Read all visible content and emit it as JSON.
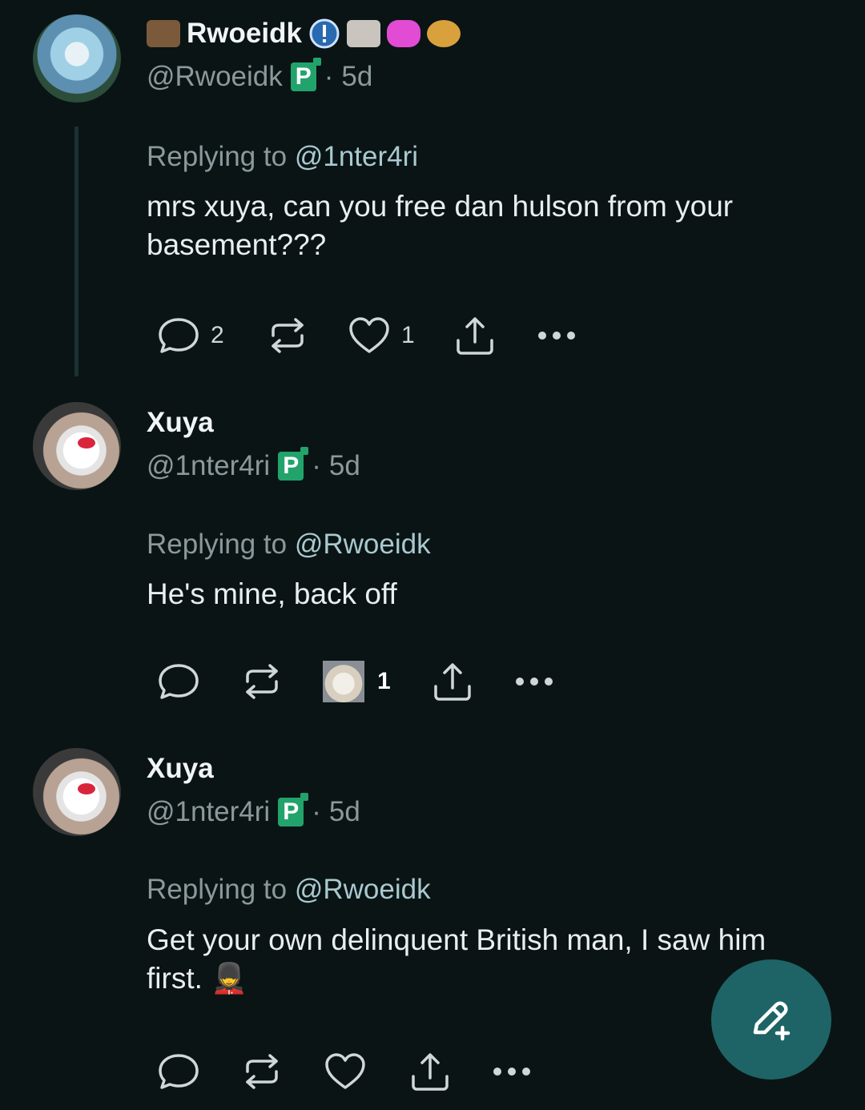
{
  "posts": [
    {
      "display_name": "Rwoeidk",
      "handle": "@Rwoeidk",
      "time": "5d",
      "replying_prefix": "Replying to",
      "replying_to": "@1nter4ri",
      "text": "mrs xuya, can you free dan hulson from your basement???",
      "actions": {
        "replies": "2",
        "likes": "1"
      }
    },
    {
      "display_name": "Xuya",
      "handle": "@1nter4ri",
      "time": "5d",
      "replying_prefix": "Replying to",
      "replying_to": "@Rwoeidk",
      "text": "He's mine, back off",
      "actions": {
        "likes": "1"
      }
    },
    {
      "display_name": "Xuya",
      "handle": "@1nter4ri",
      "time": "5d",
      "replying_prefix": "Replying to",
      "replying_to": "@Rwoeidk",
      "text": "Get your own delinquent British man, I saw him first. 💂",
      "actions": {}
    }
  ],
  "badge_letter": "P",
  "separator": "·",
  "colors": {
    "background": "#0a1415",
    "fab": "#1e6466",
    "badge": "#22a36b"
  },
  "icons": [
    "reply-icon",
    "repost-icon",
    "like-icon",
    "share-icon",
    "more-icon",
    "compose-icon",
    "info-badge-icon"
  ]
}
